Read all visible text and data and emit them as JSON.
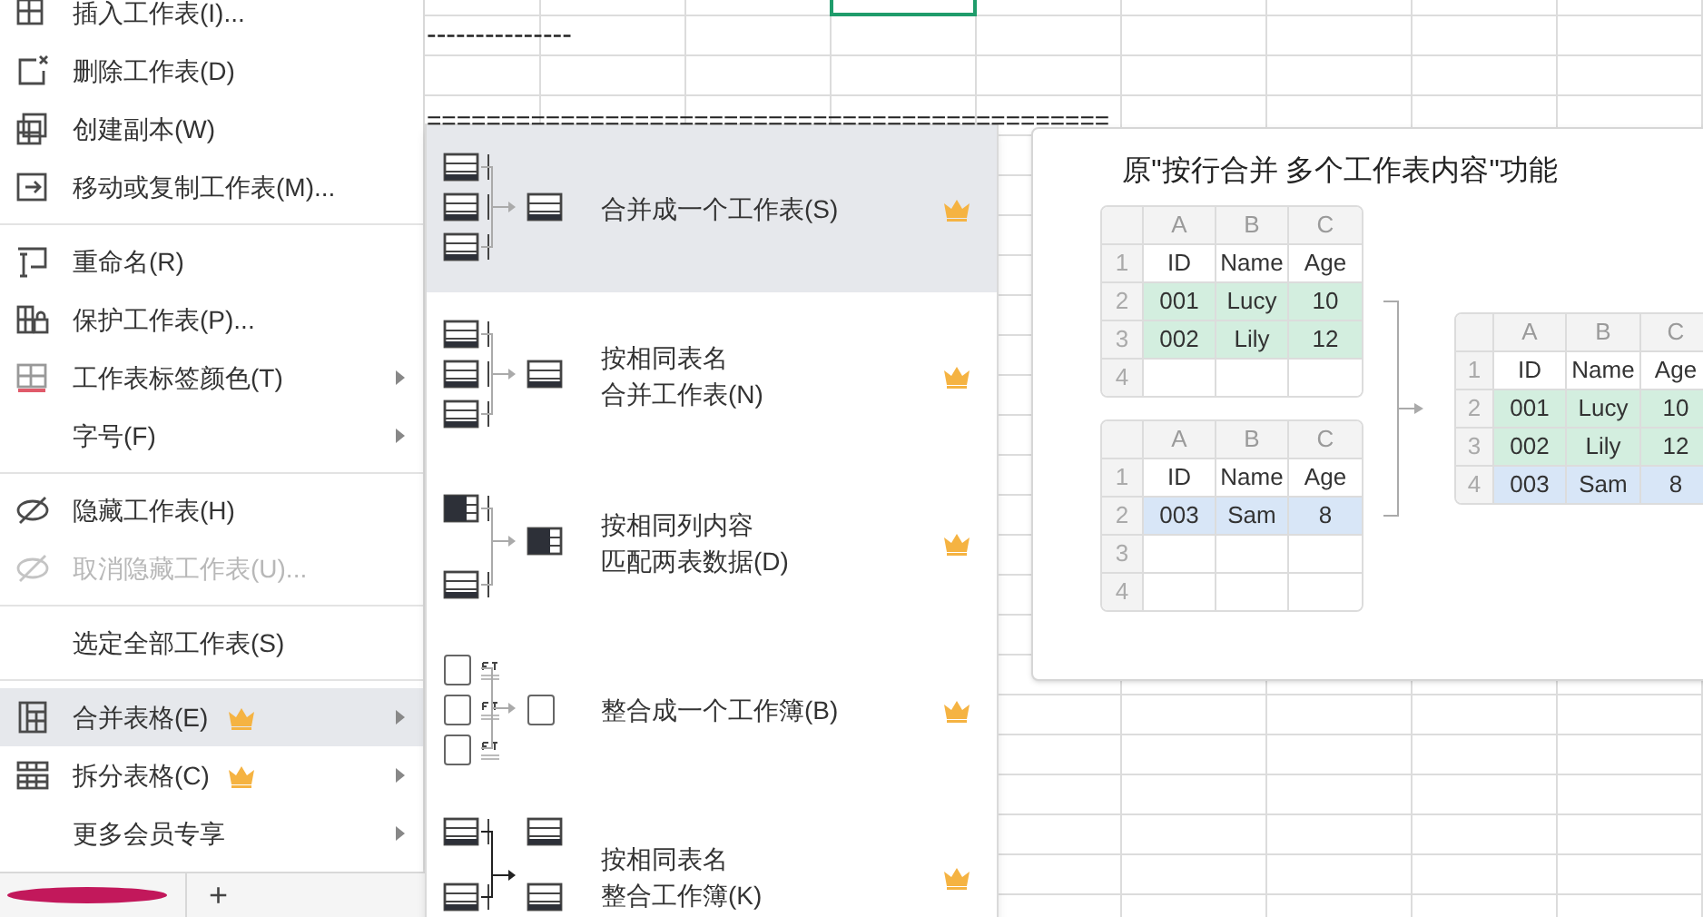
{
  "sheet": {
    "cell_texts": [
      "---------------",
      "=============================================="
    ]
  },
  "menu": {
    "sections": [
      [
        {
          "label": "插入工作表(I)...",
          "disabled": false,
          "selected": false,
          "vip": false,
          "submenu": false
        },
        {
          "label": "删除工作表(D)",
          "disabled": false,
          "selected": false,
          "vip": false,
          "submenu": false
        },
        {
          "label": "创建副本(W)",
          "disabled": false,
          "selected": false,
          "vip": false,
          "submenu": false
        },
        {
          "label": "移动或复制工作表(M)...",
          "disabled": false,
          "selected": false,
          "vip": false,
          "submenu": false
        }
      ],
      [
        {
          "label": "重命名(R)",
          "disabled": false,
          "selected": false,
          "vip": false,
          "submenu": false
        },
        {
          "label": "保护工作表(P)...",
          "disabled": false,
          "selected": false,
          "vip": false,
          "submenu": false
        },
        {
          "label": "工作表标签颜色(T)",
          "disabled": false,
          "selected": false,
          "vip": false,
          "submenu": true
        },
        {
          "label": "字号(F)",
          "disabled": false,
          "selected": false,
          "vip": false,
          "submenu": true
        }
      ],
      [
        {
          "label": "隐藏工作表(H)",
          "disabled": false,
          "selected": false,
          "vip": false,
          "submenu": false
        },
        {
          "label": "取消隐藏工作表(U)...",
          "disabled": true,
          "selected": false,
          "vip": false,
          "submenu": false
        }
      ],
      [
        {
          "label": "选定全部工作表(S)",
          "disabled": false,
          "selected": false,
          "vip": false,
          "submenu": false
        }
      ],
      [
        {
          "label": "合并表格(E)",
          "disabled": false,
          "selected": true,
          "vip": true,
          "submenu": true
        },
        {
          "label": "拆分表格(C)",
          "disabled": false,
          "selected": false,
          "vip": true,
          "submenu": true
        },
        {
          "label": "更多会员专享",
          "disabled": false,
          "selected": false,
          "vip": false,
          "submenu": true
        }
      ]
    ]
  },
  "sheet_tabs": {
    "add_button": "+"
  },
  "submenu": {
    "items": [
      {
        "lines": [
          "合并成一个工作表(S)"
        ],
        "selected": true,
        "vip": true
      },
      {
        "lines": [
          "按相同表名",
          "合并工作表(N)"
        ],
        "selected": false,
        "vip": true
      },
      {
        "lines": [
          "按相同列内容",
          "匹配两表数据(D)"
        ],
        "selected": false,
        "vip": true
      },
      {
        "lines": [
          "整合成一个工作簿(B)"
        ],
        "selected": false,
        "vip": true
      },
      {
        "lines": [
          "按相同表名",
          "整合工作簿(K)"
        ],
        "selected": false,
        "vip": true
      }
    ]
  },
  "preview": {
    "title": "原\"按行合并 多个工作表内容\"功能",
    "tables": [
      {
        "columns": [
          "A",
          "B",
          "C"
        ],
        "rows": [
          {
            "number": "1",
            "cells": [
              "ID",
              "Name",
              "Age"
            ],
            "color": "#ffffff"
          },
          {
            "number": "2",
            "cells": [
              "001",
              "Lucy",
              "10"
            ],
            "color": "#d3eedf"
          },
          {
            "number": "3",
            "cells": [
              "002",
              "Lily",
              "12"
            ],
            "color": "#d3eedf"
          },
          {
            "number": "4",
            "color": "#ffffff"
          }
        ]
      },
      {
        "columns": [
          "A",
          "B",
          "C"
        ],
        "rows": [
          {
            "number": "1",
            "cells": [
              "ID",
              "Name",
              "Age"
            ],
            "color": "#ffffff"
          },
          {
            "number": "2",
            "cells": [
              "003",
              "Sam",
              "8"
            ],
            "color": "#d8e6f7"
          },
          {
            "number": "3",
            "color": "#ffffff"
          },
          {
            "number": "4",
            "color": "#ffffff"
          }
        ]
      },
      {
        "columns": [
          "A",
          "B",
          "C"
        ],
        "rows": [
          {
            "number": "1",
            "cells": [
              "ID",
              "Name",
              "Age"
            ],
            "color": "#ffffff"
          },
          {
            "number": "2",
            "cells": [
              "001",
              "Lucy",
              "10"
            ],
            "color": "#d3eedf"
          },
          {
            "number": "3",
            "cells": [
              "002",
              "Lily",
              "12"
            ],
            "color": "#d3eedf"
          },
          {
            "number": "4",
            "cells": [
              "003",
              "Sam",
              "8"
            ],
            "color": "#d8e6f7"
          }
        ]
      }
    ]
  }
}
